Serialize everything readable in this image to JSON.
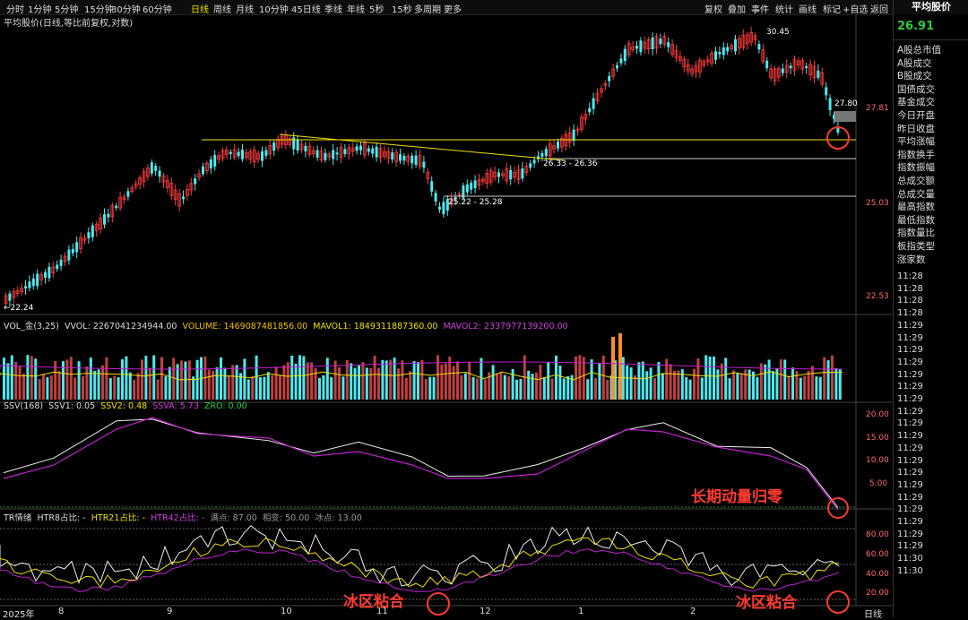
{
  "toolbar": {
    "periods": [
      "分时",
      "1分钟",
      "5分钟",
      "15分钟",
      "30分钟",
      "60分钟",
      "日线",
      "周线",
      "月线",
      "10分钟",
      "45日线",
      "季线",
      "年线",
      "5秒",
      "15秒",
      "多周期",
      "更多"
    ],
    "active_period": "日线",
    "actions": [
      "复权",
      "叠加",
      "事件",
      "统计",
      "画线",
      "标记",
      "+自选",
      "返回"
    ]
  },
  "main": {
    "title": "平均股价(日线,等比前复权,对数)",
    "y_ticks": [
      "27.81",
      "25.03",
      "22.53"
    ],
    "price_labels": {
      "high": "30.45",
      "low": "22.24",
      "last": "27.80",
      "support": "26.33 - 26.36",
      "bottom": "25.22 - 25.28"
    }
  },
  "volume": {
    "name": "VOL_金(3,25)",
    "vvol": "VVOL: 2267041234944.00",
    "volume": "VOLUME: 1469087481856.00",
    "mavol1": "MAVOL1: 1849311887360.00",
    "mavol2": "MAVOL2: 2337977139200.00"
  },
  "ssv": {
    "name": "SSV(168)",
    "ssv1": "SSV1: 0.05",
    "ssv2": "SSV2: 0.48",
    "ssva": "SSVA: 5.73",
    "zro": "ZRO: 0.00",
    "y_ticks": [
      "20.00",
      "15.00",
      "10.00",
      "5.00"
    ]
  },
  "tr": {
    "name": "TR情绪",
    "htr8": "HTR8占比: -",
    "htr21": "HTR21占比: -",
    "htr42": "HTR42占比: -",
    "full": "满点: 87.00",
    "mid": "相变: 50.00",
    "ice": "冰点: 13.00",
    "y_ticks": [
      "80.00",
      "60.00",
      "40.00",
      "20.00"
    ]
  },
  "annotations": {
    "ssv_note": "长期动量归零",
    "tr_note1": "冰区粘合",
    "tr_note2": "冰区粘合"
  },
  "x_axis": {
    "labels": [
      "2025年",
      "8",
      "9",
      "10",
      "11",
      "12",
      "1",
      "2"
    ],
    "period_label": "日线"
  },
  "sidebar": {
    "title": "平均股价",
    "price": "26.91",
    "items": [
      "A股总市值",
      "A股成交",
      "B股成交",
      "国债成交",
      "基金成交",
      "今日开盘",
      "昨日收盘",
      "平均涨幅",
      "指数换手",
      "指数振幅",
      "总成交额",
      "总成交量",
      "最高指数",
      "最低指数",
      "指数量比",
      "板指类型",
      "涨家数"
    ],
    "times": [
      "11:28",
      "11:28",
      "11:28",
      "11:28",
      "11:29",
      "11:29",
      "11:29",
      "11:29",
      "11:29",
      "11:29",
      "11:29",
      "11:29",
      "11:29",
      "11:29",
      "11:29",
      "11:29",
      "11:29",
      "11:29",
      "11:29",
      "11:29",
      "11:29",
      "11:29",
      "11:29",
      "11:30",
      "11:30"
    ]
  },
  "colors": {
    "up": "#ff3b3b",
    "down": "#4ee8ee",
    "ma_yellow": "#f0e000",
    "ma_purple": "#c020d0",
    "note_red": "#ff3b30",
    "positive_green": "#2ecc40"
  }
}
